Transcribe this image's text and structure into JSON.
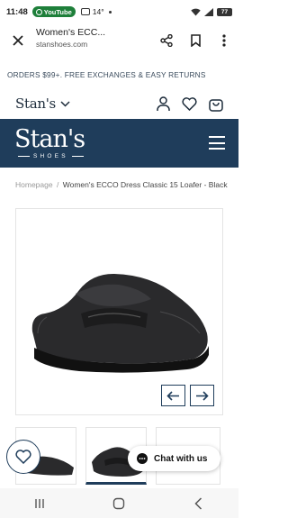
{
  "status_bar": {
    "time": "11:48",
    "badge": "YouTube",
    "temperature": "14°",
    "battery": "77"
  },
  "browser": {
    "title": "Women's ECC...",
    "url": "stanshoes.com"
  },
  "promo": {
    "text": "ORDERS $99+. FREE EXCHANGES & EASY RETURNS"
  },
  "store_nav": {
    "store_label": "Stan's"
  },
  "brand": {
    "logo_main": "Stan's",
    "logo_sub": "SHOES",
    "header_color": "#1f3d5b"
  },
  "breadcrumb": {
    "home": "Homepage",
    "separator": "/",
    "current": "Women's ECCO Dress Classic 15 Loafer - Black"
  },
  "chat": {
    "label": "Chat with us"
  },
  "icons": [
    "close-icon",
    "share-icon",
    "bookmark-icon",
    "more-vert-icon",
    "chevron-down-icon",
    "account-icon",
    "heart-icon",
    "cart-icon",
    "menu-icon",
    "arrow-left-icon",
    "arrow-right-icon",
    "chat-icon"
  ]
}
